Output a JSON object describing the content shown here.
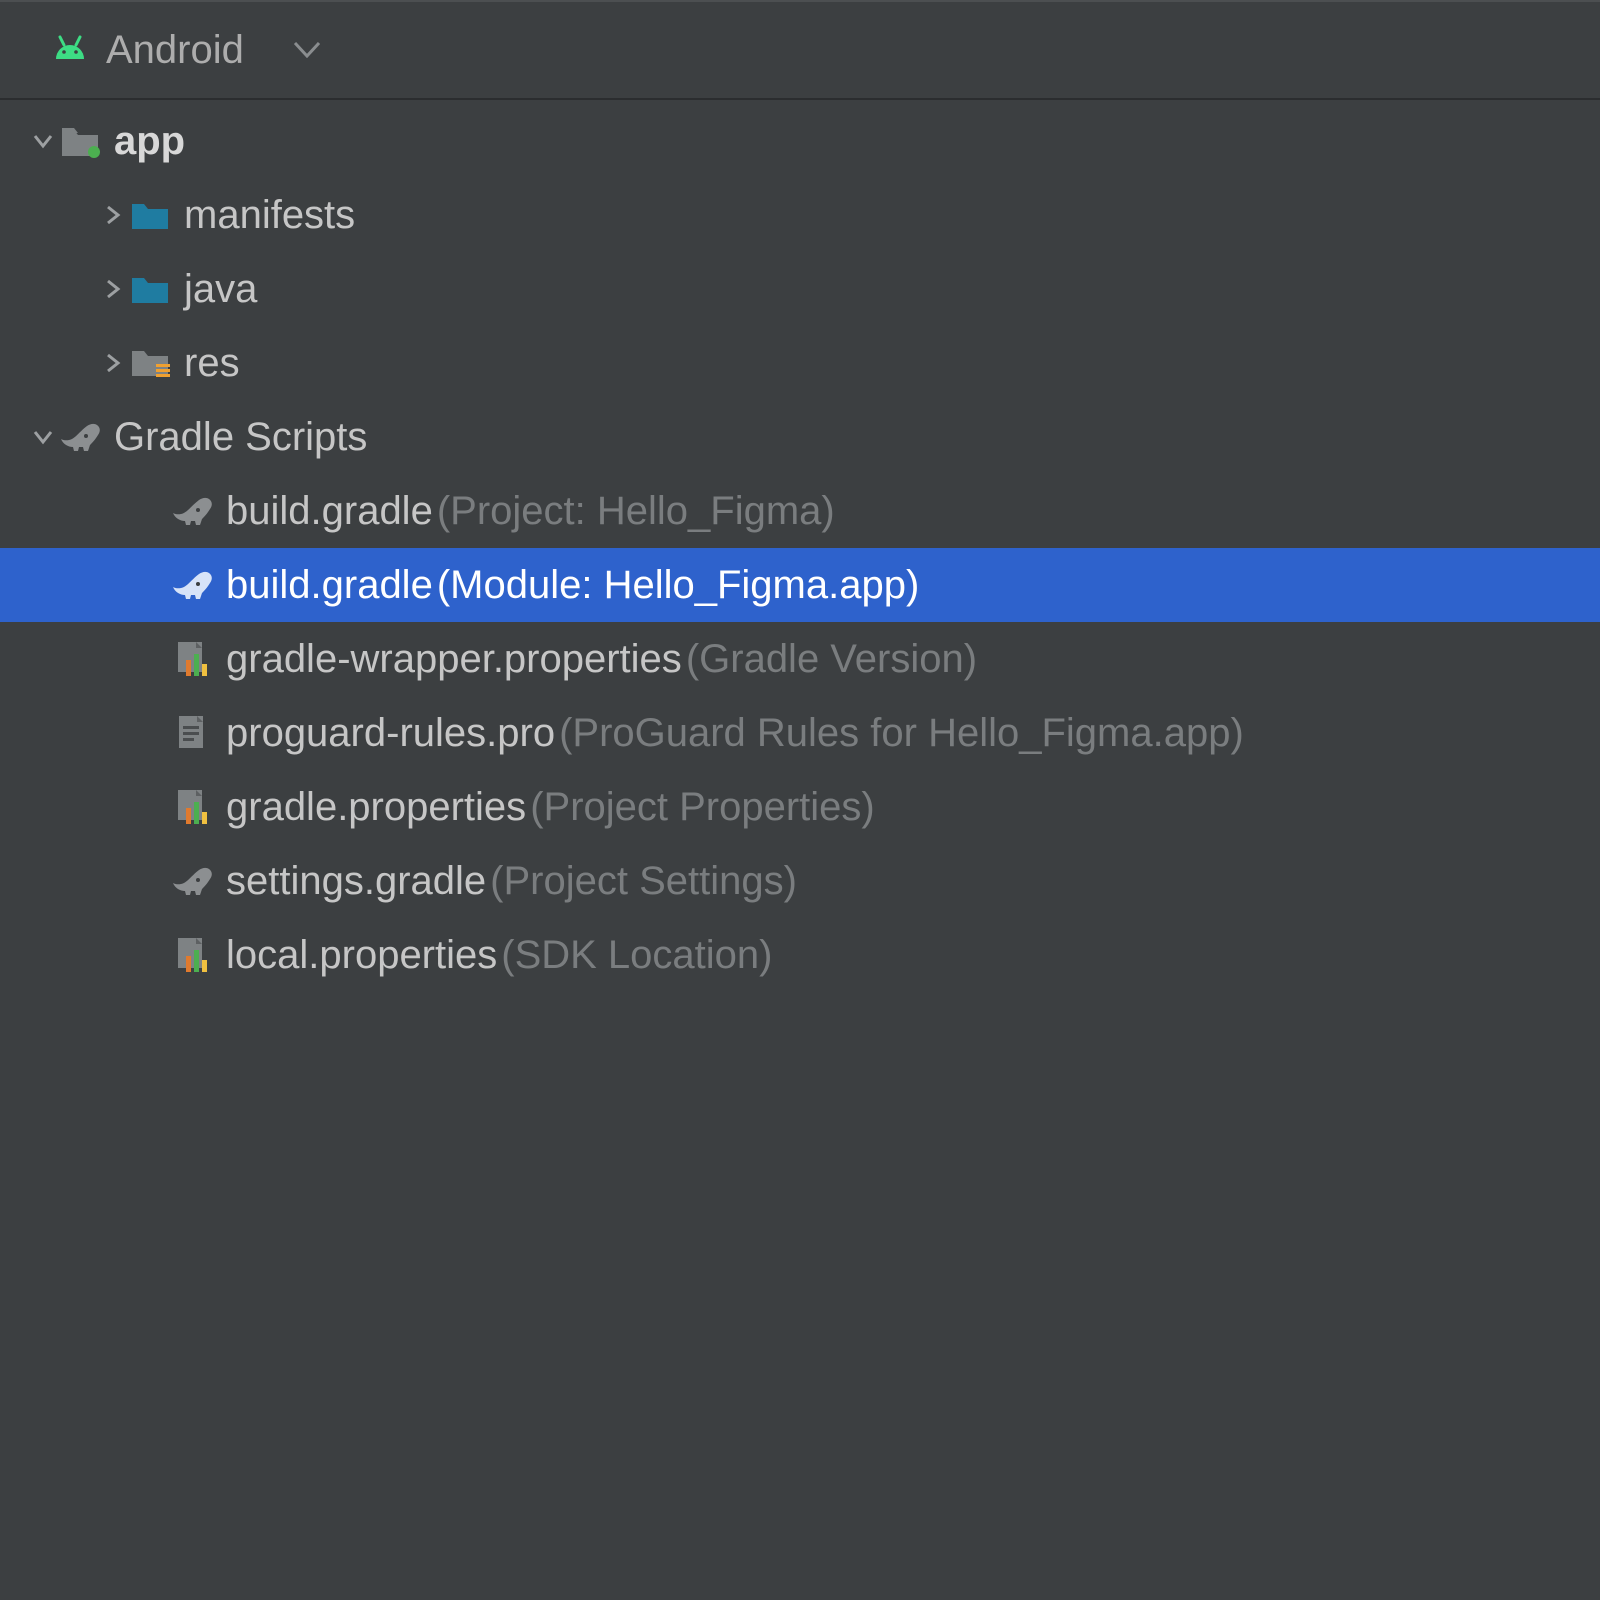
{
  "header": {
    "view_label": "Android"
  },
  "tree": {
    "app": {
      "label": "app",
      "children": {
        "manifests": "manifests",
        "java": "java",
        "res": "res"
      }
    },
    "gradle": {
      "label": "Gradle Scripts",
      "items": [
        {
          "name": "build.gradle",
          "hint": "(Project: Hello_Figma)",
          "icon": "elephant",
          "selected": false
        },
        {
          "name": "build.gradle",
          "hint": "(Module: Hello_Figma.app)",
          "icon": "elephant",
          "selected": true
        },
        {
          "name": "gradle-wrapper.properties",
          "hint": "(Gradle Version)",
          "icon": "props",
          "selected": false
        },
        {
          "name": "proguard-rules.pro",
          "hint": "(ProGuard Rules for Hello_Figma.app)",
          "icon": "textfile",
          "selected": false
        },
        {
          "name": "gradle.properties",
          "hint": "(Project Properties)",
          "icon": "props",
          "selected": false
        },
        {
          "name": "settings.gradle",
          "hint": "(Project Settings)",
          "icon": "elephant",
          "selected": false
        },
        {
          "name": "local.properties",
          "hint": "(SDK Location)",
          "icon": "props",
          "selected": false
        }
      ]
    }
  }
}
